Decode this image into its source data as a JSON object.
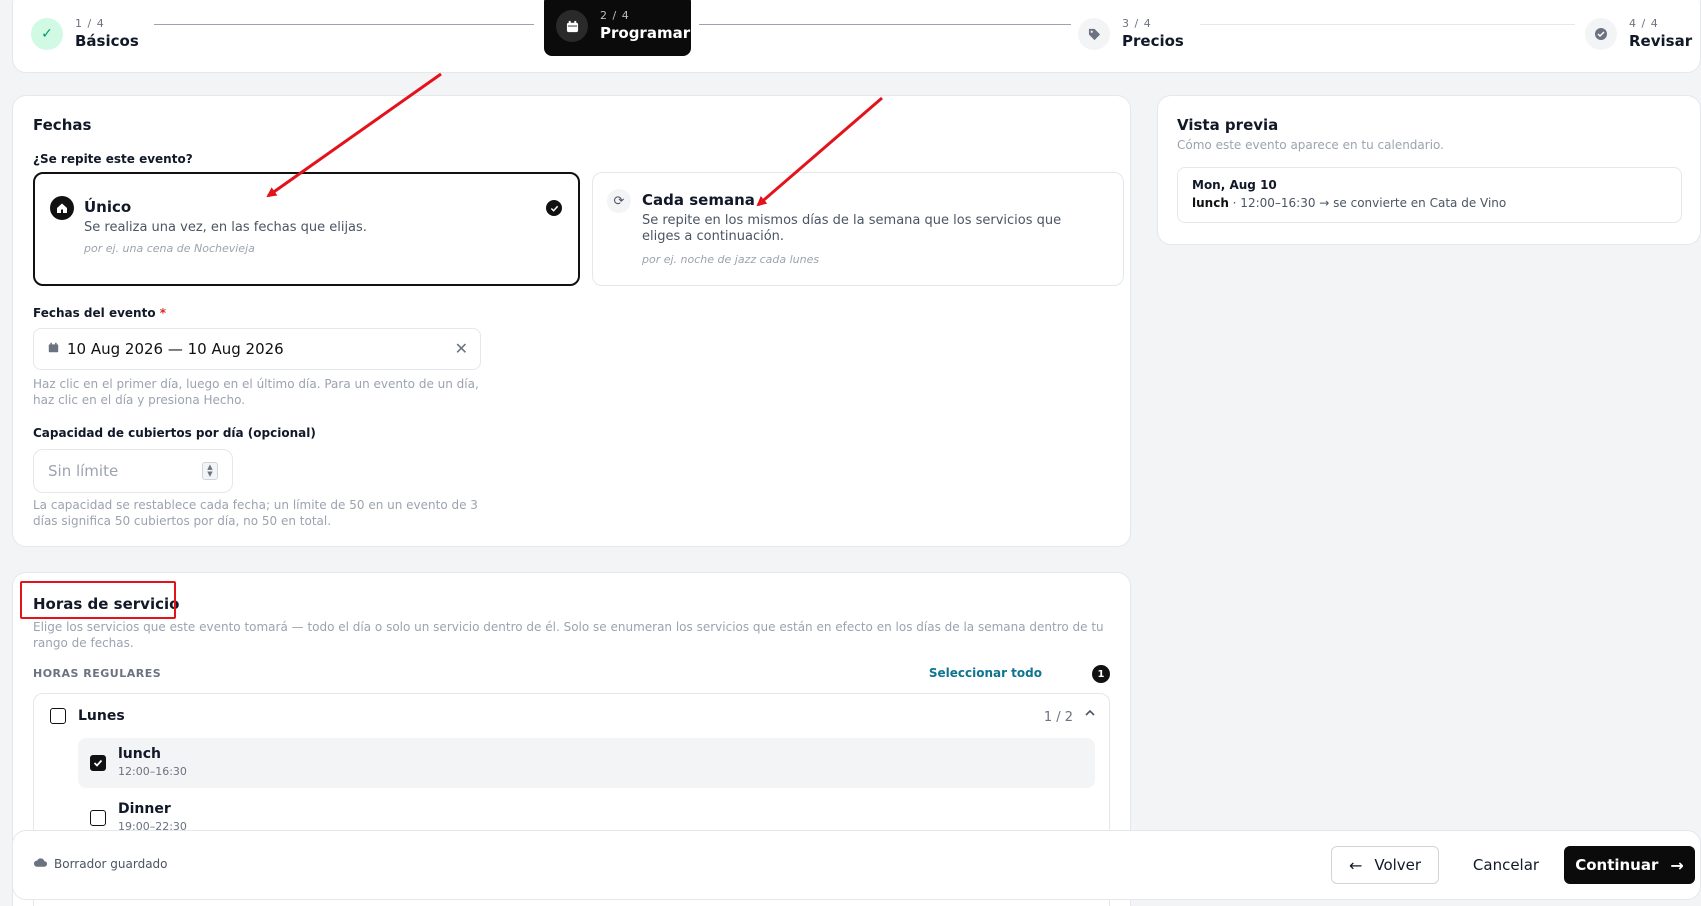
{
  "stepper": {
    "steps": [
      {
        "num": "1 / 4",
        "name": "Básicos",
        "state": "done"
      },
      {
        "num": "2 / 4",
        "name": "Programar",
        "state": "active"
      },
      {
        "num": "3 / 4",
        "name": "Precios",
        "state": "pending"
      },
      {
        "num": "4 / 4",
        "name": "Revisar",
        "state": "pending"
      }
    ]
  },
  "fechas": {
    "title": "Fechas",
    "repeat_label": "¿Se repite este evento?",
    "options": [
      {
        "title": "Único",
        "desc": "Se realiza una vez, en las fechas que elijas.",
        "example": "por ej. una cena de Nochevieja",
        "selected": true
      },
      {
        "title": "Cada semana",
        "desc": "Se repite en los mismos días de la semana que los servicios que eliges a continuación.",
        "example": "por ej. noche de jazz cada lunes",
        "selected": false
      }
    ],
    "dates_label": "Fechas del evento",
    "required_mark": "*",
    "dates_value": "10 Aug 2026 — 10 Aug 2026",
    "dates_help": "Haz clic en el primer día, luego en el último día. Para un evento de un día, haz clic en el día y presiona Hecho.",
    "capacity_label": "Capacidad de cubiertos por día (opcional)",
    "capacity_placeholder": "Sin límite",
    "capacity_help": "La capacidad se restablece cada fecha; un límite de 50 en un evento de 3 días significa 50 cubiertos por día, no 50 en total."
  },
  "preview": {
    "title": "Vista previa",
    "subtitle": "Cómo este evento aparece en tu calendario.",
    "date": "Mon, Aug 10",
    "service": "lunch",
    "detail": " · 12:00–16:30 → se convierte en Cata de Vino"
  },
  "horas": {
    "title": "Horas de servicio",
    "desc": "Elige los servicios que este evento tomará — todo el día o solo un servicio dentro de él. Solo se enumeran los servicios que están en efecto en los días de la semana dentro de tu rango de fechas.",
    "section_label": "HORAS REGULARES",
    "select_all": "Seleccionar todo",
    "badge": "1",
    "days": [
      {
        "name": "Lunes",
        "count": "1 / 2",
        "services": [
          {
            "name": "lunch",
            "time": "12:00–16:30",
            "checked": true
          },
          {
            "name": "Dinner",
            "time": "19:00–22:30",
            "checked": false
          }
        ]
      }
    ]
  },
  "footer": {
    "status": "Borrador guardado",
    "back": "Volver",
    "cancel": "Cancelar",
    "continue": "Continuar"
  },
  "colors": {
    "accent": "#0b0b0b",
    "link": "#0e7490",
    "done_bg": "#d1fae5",
    "done_check": "#059669",
    "annotation": "#e3121b",
    "required": "#dc2626"
  }
}
